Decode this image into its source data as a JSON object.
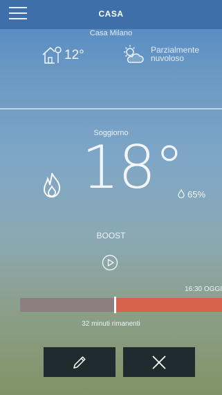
{
  "header": {
    "title": "CASA",
    "menu_icon": "menu-icon"
  },
  "outdoor": {
    "location": "Casa Milano",
    "temperature": "12°",
    "house_icon": "house-thermometer-icon",
    "weather_icon": "partly-cloudy-icon",
    "weather_line1": "Parzialmente",
    "weather_line2": "nuvoloso"
  },
  "room": {
    "name": "Soggiorno",
    "temperature": "18°",
    "humidity": "65%",
    "heating_icon": "flame-icon",
    "humidity_icon": "drop-icon"
  },
  "boost": {
    "label": "BOOST",
    "play_icon": "play-icon",
    "end_time": "16:30 OGGI",
    "progress_fraction": 0.47,
    "remaining_text": "32 minuti rimanenti"
  },
  "actions": {
    "edit_icon": "pencil-icon",
    "cancel_icon": "close-icon"
  },
  "colors": {
    "topbar": "#3e6fa8",
    "progress_remaining": "#d8634c",
    "progress_elapsed": "#8c7f80",
    "button_bg": "#1f2c2f"
  }
}
